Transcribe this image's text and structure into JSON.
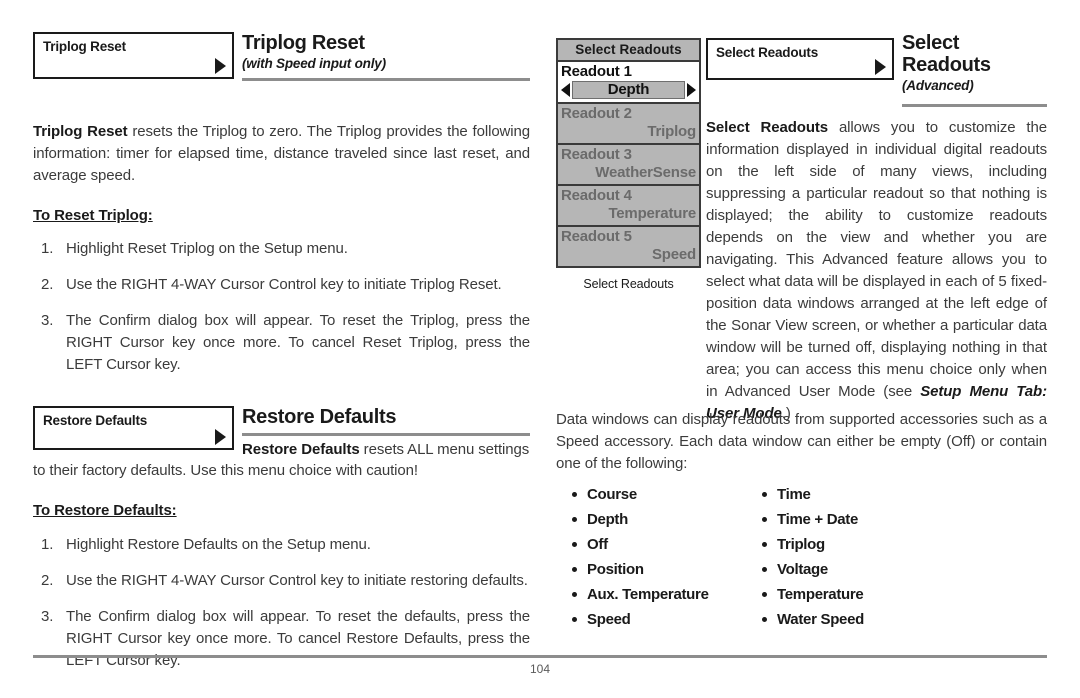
{
  "page": {
    "number": "104"
  },
  "left_column": {
    "section1": {
      "menu_box_label": "Triplog Reset",
      "heading": "Triplog Reset",
      "subheading": "(with Speed input only)",
      "intro_bold": "Triplog Reset",
      "intro_rest": " resets the Triplog to zero. The Triplog provides the following information: timer for elapsed time, distance traveled since last reset, and average speed.",
      "steps_title": "To Reset Triplog:",
      "steps": [
        {
          "num": "1.",
          "text": "Highlight Reset Triplog on the Setup menu."
        },
        {
          "num": "2.",
          "text": "Use the RIGHT 4-WAY Cursor Control key to initiate Triplog Reset."
        },
        {
          "num": "3.",
          "text": "The Confirm dialog box will appear. To reset the Triplog, press the RIGHT Cursor key once more. To cancel Reset Triplog, press the LEFT Cursor key."
        }
      ]
    },
    "section2": {
      "menu_box_label": "Restore Defaults",
      "heading": "Restore Defaults",
      "intro_bold": "Restore Defaults",
      "intro_rest": " resets ALL menu settings to their factory defaults. Use this menu choice with caution!",
      "steps_title": "To Restore Defaults:",
      "steps": [
        {
          "num": "1.",
          "text": "Highlight Restore Defaults on the Setup menu."
        },
        {
          "num": "2.",
          "text": "Use the RIGHT 4-WAY Cursor Control key to initiate restoring defaults."
        },
        {
          "num": "3.",
          "text": "The Confirm dialog box will appear. To reset the defaults, press the RIGHT Cursor key once more. To cancel Restore Defaults, press the LEFT Cursor key."
        }
      ]
    }
  },
  "lcd": {
    "title": "Select Readouts",
    "caption": "Select Readouts",
    "selected_index": 0,
    "rows": [
      {
        "label": "Readout 1",
        "value": "Depth",
        "selected": true
      },
      {
        "label": "Readout 2",
        "value": "Triplog",
        "selected": false
      },
      {
        "label": "Readout 3",
        "value": "WeatherSense",
        "selected": false
      },
      {
        "label": "Readout 4",
        "value": "Temperature",
        "selected": false
      },
      {
        "label": "Readout 5",
        "value": "Speed",
        "selected": false
      }
    ],
    "colors": {
      "screen_bg": "#b6b6b6",
      "selected_bg": "#ffffff",
      "border": "#3a3a3a",
      "dim_text": "#6b6b6b"
    }
  },
  "right_column": {
    "menu_box_label": "Select Readouts",
    "heading_line1": "Select",
    "heading_line2": "Readouts",
    "subheading": "(Advanced)",
    "para1_bold": "Select Readouts",
    "para1_rest": " allows you to customize the information displayed in individual digital readouts on the left side of many views, including suppressing a particular readout so that nothing is displayed; the ability to customize readouts depends on the view and whether you are navigating. This Advanced feature allows you to select what data will be displayed in each of 5 fixed-position data windows arranged at the left edge of the Sonar View screen, or whether a particular data window will be turned off, displaying nothing in that area; you can access this menu choice only when in Advanced User Mode (see ",
    "para1_italic_bold": "Setup Menu Tab: User Mode",
    "para1_tail": ".)",
    "para2": "Data windows can display readouts from supported accessories such as a Speed accessory. Each data window can either be empty (Off) or contain one of the following:",
    "bullets_col1": [
      "Course",
      "Depth",
      "Off",
      "Position",
      "Aux. Temperature",
      "Speed"
    ],
    "bullets_col2": [
      "Time",
      "Time + Date",
      "Triplog",
      "Voltage",
      "Temperature",
      "Water Speed"
    ]
  }
}
